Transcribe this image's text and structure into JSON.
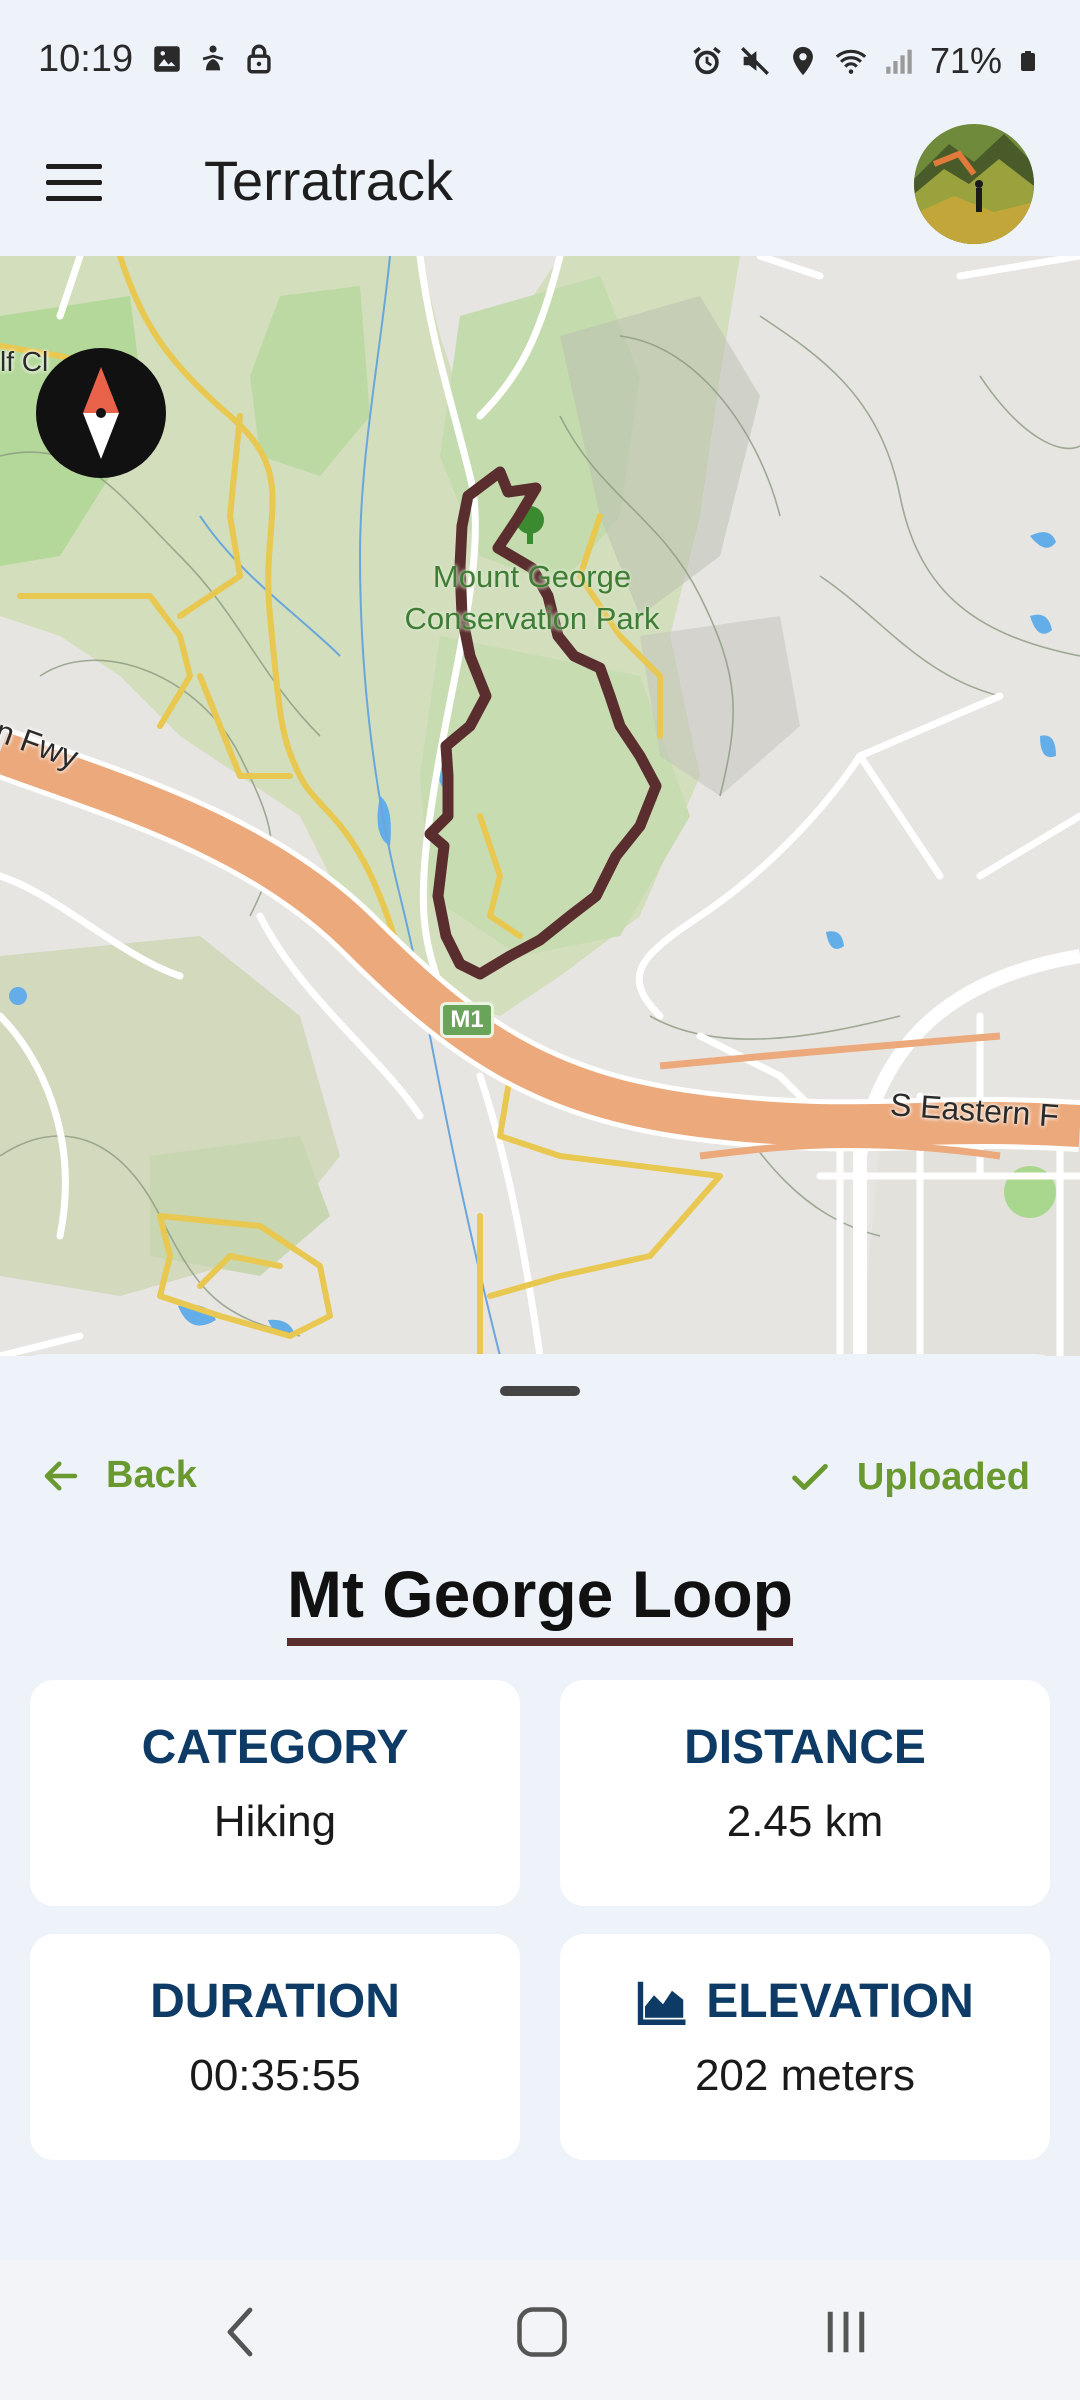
{
  "status": {
    "time": "10:19",
    "battery": "71%",
    "left_icons": [
      "image-icon",
      "accessibility-icon",
      "lock-icon"
    ],
    "right_icons": [
      "alarm-icon",
      "mute-icon",
      "location-icon",
      "wifi-icon",
      "signal-icon",
      "battery-icon"
    ]
  },
  "app_bar": {
    "title": "Terratrack",
    "menu_icon": "hamburger-menu-icon",
    "avatar": "profile-avatar"
  },
  "map": {
    "park_label_line1": "Mount George",
    "park_label_line2": "Conservation Park",
    "road_label_left": "n Fwy",
    "road_label_right": "S Eastern F",
    "road_label_top": "lf Cl",
    "highway_badge": "M1",
    "route_color": "#5a2e2e"
  },
  "sheet": {
    "back_label": "Back",
    "status_label": "Uploaded",
    "trail_name": "Mt George Loop",
    "accent_color": "#6a9a2f",
    "heading_color": "#0d3b66",
    "stats": [
      {
        "label": "CATEGORY",
        "value": "Hiking"
      },
      {
        "label": "DISTANCE",
        "value": "2.45 km"
      },
      {
        "label": "DURATION",
        "value": "00:35:55"
      },
      {
        "label": "ELEVATION",
        "value": "202 meters",
        "icon": "area-chart-icon"
      }
    ]
  },
  "nav": {
    "back": "nav-back-icon",
    "home": "nav-home-icon",
    "recents": "nav-recents-icon"
  }
}
